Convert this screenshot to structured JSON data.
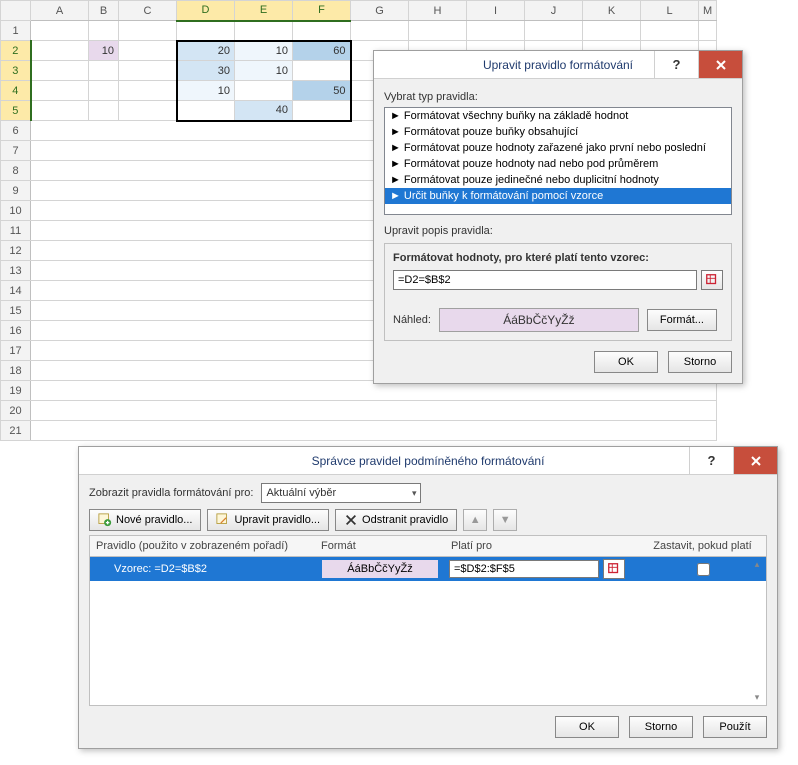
{
  "sheet": {
    "columns": [
      "A",
      "B",
      "C",
      "D",
      "E",
      "F",
      "G",
      "H",
      "I",
      "J",
      "K",
      "L",
      "M"
    ],
    "rows": [
      "1",
      "2",
      "3",
      "4",
      "5",
      "6",
      "7",
      "8",
      "9",
      "10",
      "11",
      "12",
      "13",
      "14",
      "15",
      "16",
      "17",
      "18",
      "19",
      "20",
      "21"
    ],
    "selected_cols": [
      "D",
      "E",
      "F"
    ],
    "selected_rows": [
      "2",
      "3",
      "4",
      "5"
    ],
    "cells": {
      "B2": "10",
      "D2": "20",
      "E2": "10",
      "F2": "60",
      "D3": "30",
      "E3": "10",
      "D4": "10",
      "F4": "50",
      "E5": "40"
    }
  },
  "dlg1": {
    "title": "Upravit pravidlo formátování",
    "help": "?",
    "close": "x",
    "select_type": "Vybrat typ pravidla:",
    "rules": [
      "Formátovat všechny buňky na základě hodnot",
      "Formátovat pouze buňky obsahující",
      "Formátovat pouze hodnoty zařazené jako první nebo poslední",
      "Formátovat pouze hodnoty nad nebo pod průměrem",
      "Formátovat pouze jedinečné nebo duplicitní hodnoty",
      "Určit buňky k formátování pomocí vzorce"
    ],
    "edit_desc": "Upravit popis pravidla:",
    "formula_label": "Formátovat hodnoty, pro které platí tento vzorec:",
    "formula_value": "=D2=$B$2",
    "preview_label": "Náhled:",
    "preview_text": "ÁáBbČčYyŽž",
    "format_btn": "Formát...",
    "ok": "OK",
    "cancel": "Storno"
  },
  "dlg2": {
    "title": "Správce pravidel podmíněného formátování",
    "help": "?",
    "close": "x",
    "show_for": "Zobrazit pravidla formátování pro:",
    "scope": "Aktuální výběr",
    "new_btn": "Nové pravidlo...",
    "edit_btn": "Upravit pravidlo...",
    "del_btn": "Odstranit pravidlo",
    "up": "▲",
    "down": "▼",
    "col_rule": "Pravidlo (použito v zobrazeném pořadí)",
    "col_format": "Formát",
    "col_applies": "Platí pro",
    "col_stop": "Zastavit, pokud platí",
    "row1_rule": "Vzorec: =D2=$B$2",
    "row1_fmt": "ÁáBbČčYyŽž",
    "row1_applies": "=$D$2:$F$5",
    "ok": "OK",
    "cancel": "Storno",
    "apply": "Použít"
  }
}
